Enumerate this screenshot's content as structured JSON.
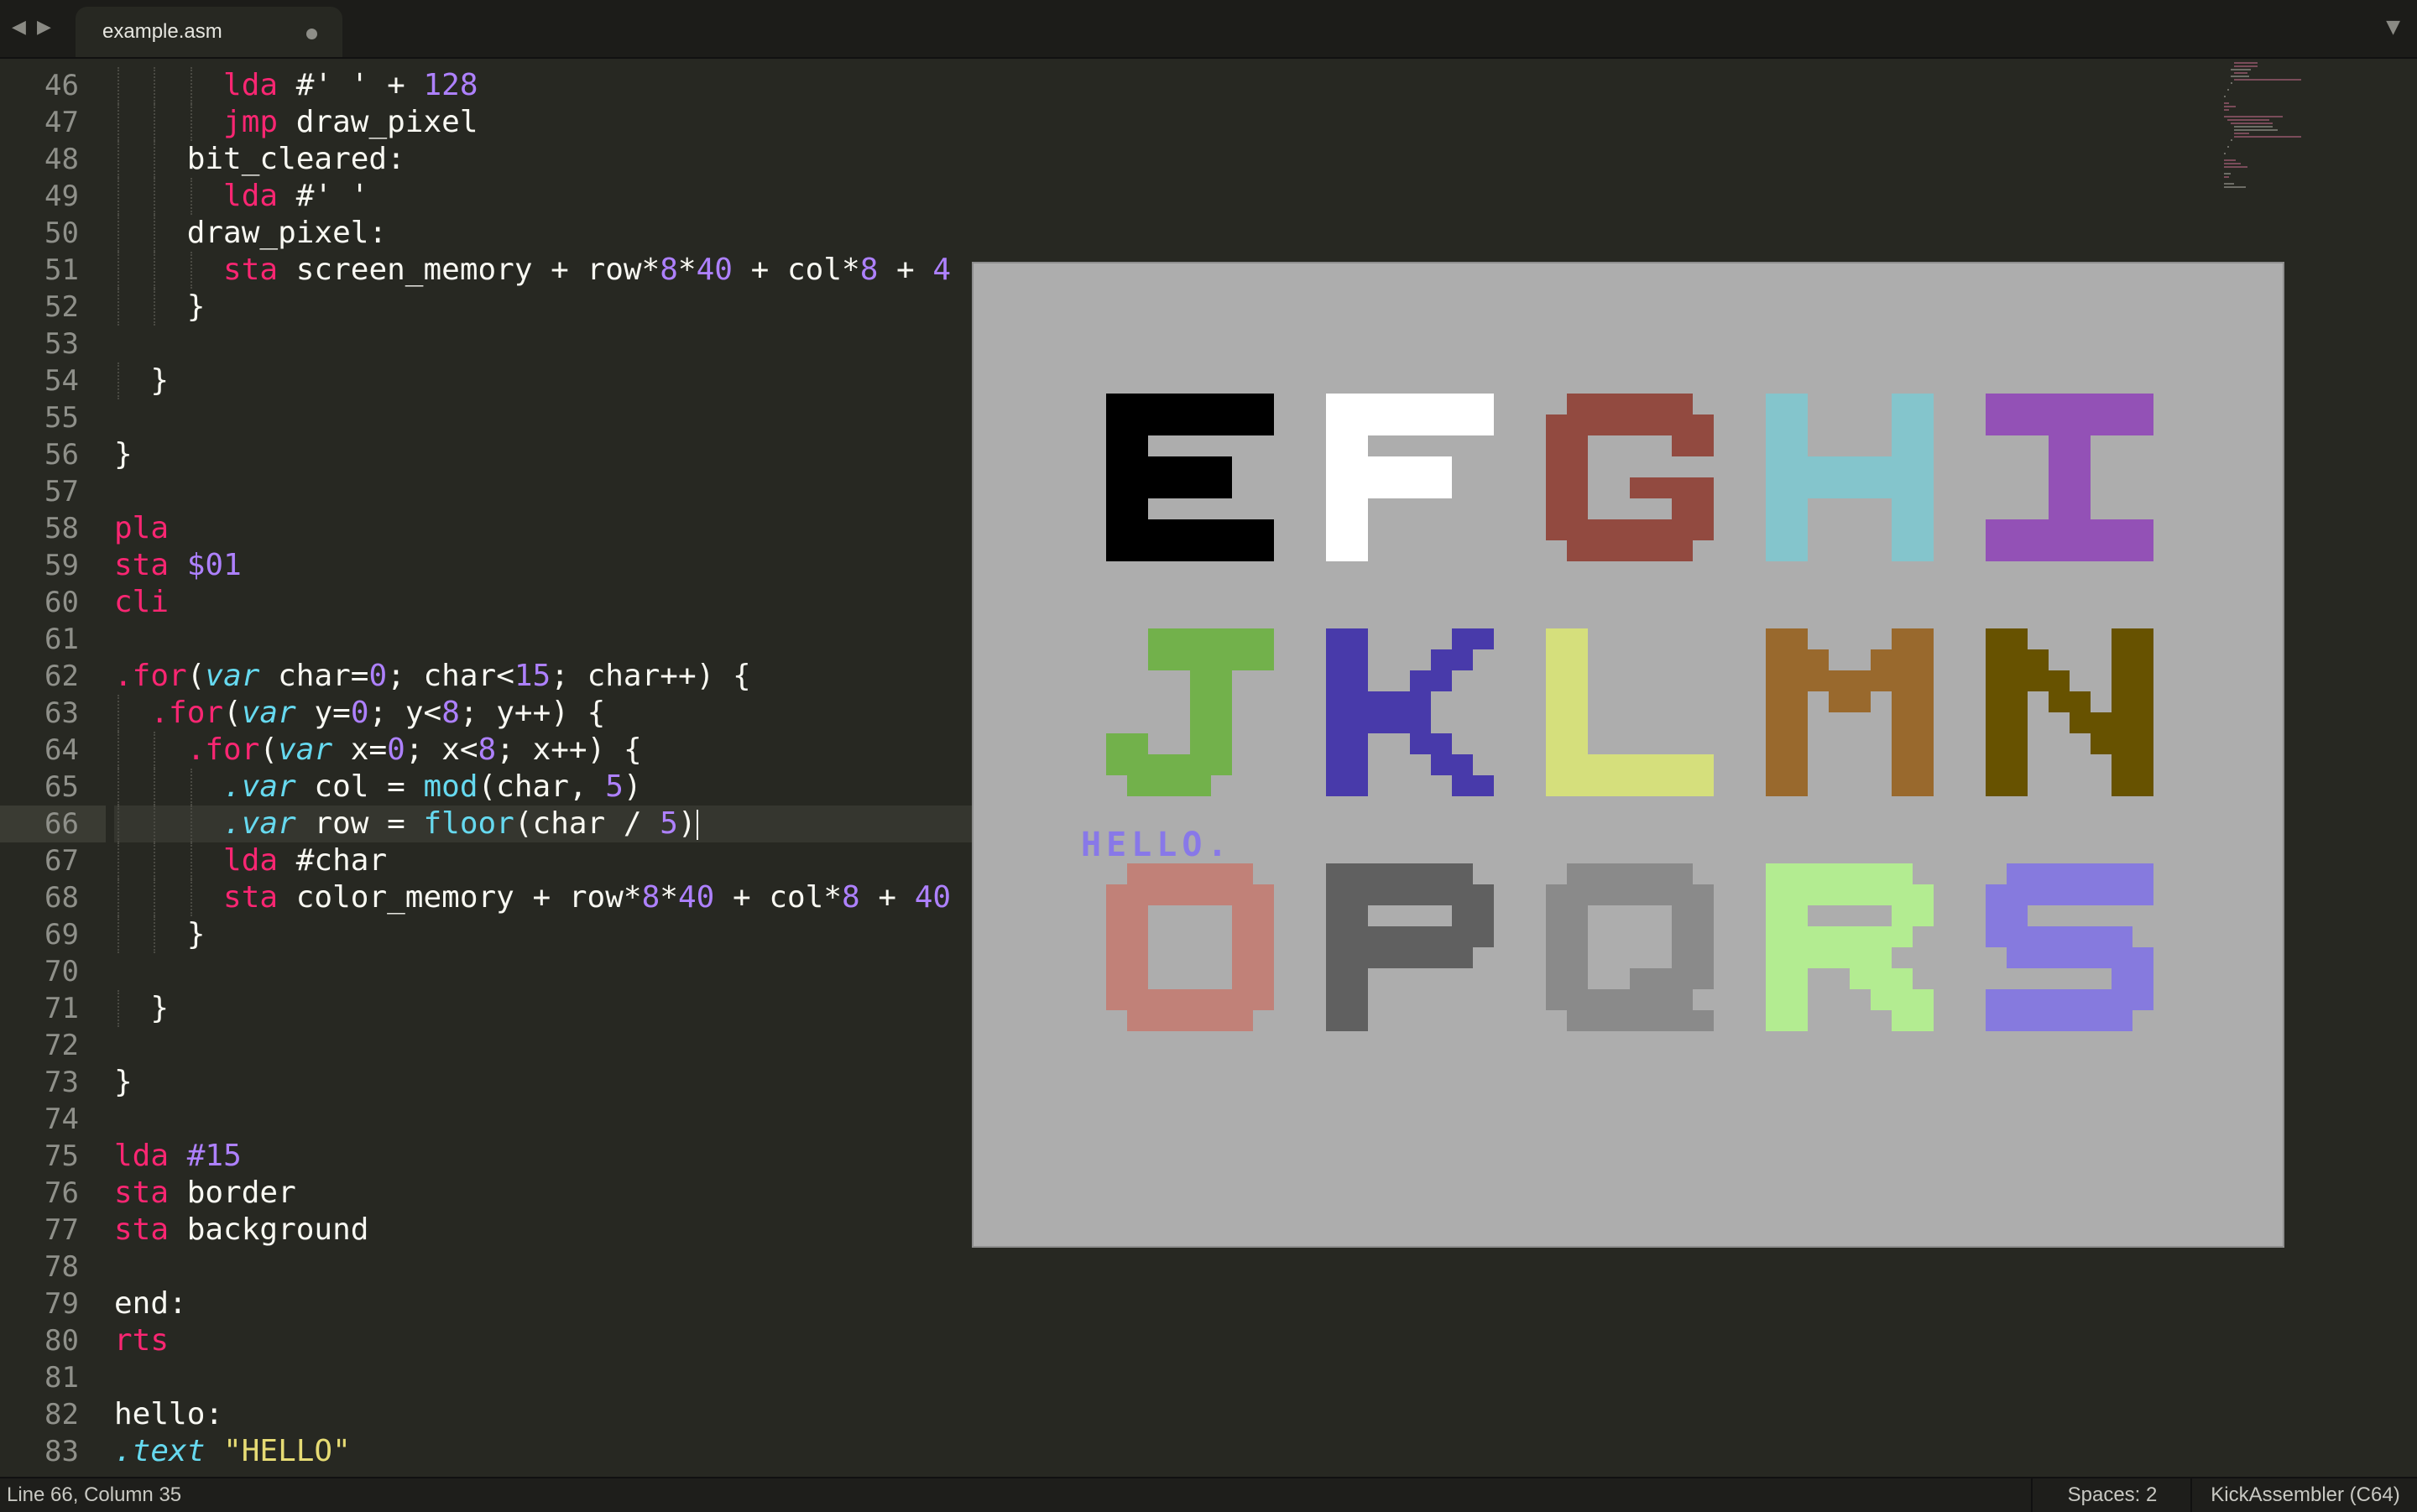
{
  "tab": {
    "title": "example.asm",
    "modified": true
  },
  "editor": {
    "line_numbers": [
      "46",
      "47",
      "48",
      "49",
      "50",
      "51",
      "52",
      "53",
      "54",
      "55",
      "56",
      "57",
      "58",
      "59",
      "60",
      "61",
      "62",
      "63",
      "64",
      "65",
      "66",
      "67",
      "68",
      "69",
      "70",
      "71",
      "72",
      "73",
      "74",
      "75",
      "76",
      "77",
      "78",
      "79",
      "80",
      "81",
      "82",
      "83"
    ],
    "current_line": "66",
    "lines": [
      "      lda #' ' + 128",
      "      jmp draw_pixel",
      "    bit_cleared:",
      "      lda #' '",
      "    draw_pixel:",
      "      sta screen_memory + row*8*40 + col*8 + 4",
      "    }",
      "",
      "  }",
      "",
      "}",
      "",
      "pla",
      "sta $01",
      "cli",
      "",
      ".for(var char=0; char<15; char++) {",
      "  .for(var y=0; y<8; y++) {",
      "    .for(var x=0; x<8; x++) {",
      "      .var col = mod(char, 5)",
      "      .var row = floor(char / 5)",
      "      lda #char",
      "      sta color_memory + row*8*40 + col*8 + 40",
      "    }",
      "",
      "  }",
      "",
      "}",
      "",
      "lda #15",
      "sta border",
      "sta background",
      "",
      "end:",
      "rts",
      "",
      "hello:",
      ".text \"HELLO\""
    ]
  },
  "emulator": {
    "background": "#adadad",
    "hello_text": "HELLO.",
    "hello_color": "#8878e8",
    "glyphs": [
      {
        "ch": "E",
        "color": "#000000"
      },
      {
        "ch": "F",
        "color": "#ffffff"
      },
      {
        "ch": "G",
        "color": "#924a40"
      },
      {
        "ch": "H",
        "color": "#84c5cc"
      },
      {
        "ch": "I",
        "color": "#9351b6"
      },
      {
        "ch": "J",
        "color": "#72b14b"
      },
      {
        "ch": "K",
        "color": "#483aaa"
      },
      {
        "ch": "L",
        "color": "#d5df7c"
      },
      {
        "ch": "M",
        "color": "#99692d"
      },
      {
        "ch": "N",
        "color": "#675200"
      },
      {
        "ch": "O",
        "color": "#c18178"
      },
      {
        "ch": "P",
        "color": "#606060"
      },
      {
        "ch": "Q",
        "color": "#8a8a8a"
      },
      {
        "ch": "R",
        "color": "#b3ec91"
      },
      {
        "ch": "S",
        "color": "#867ade"
      }
    ]
  },
  "status": {
    "position": "Line 66, Column 35",
    "indentation": "Spaces: 2",
    "syntax": "KickAssembler (C64)"
  }
}
